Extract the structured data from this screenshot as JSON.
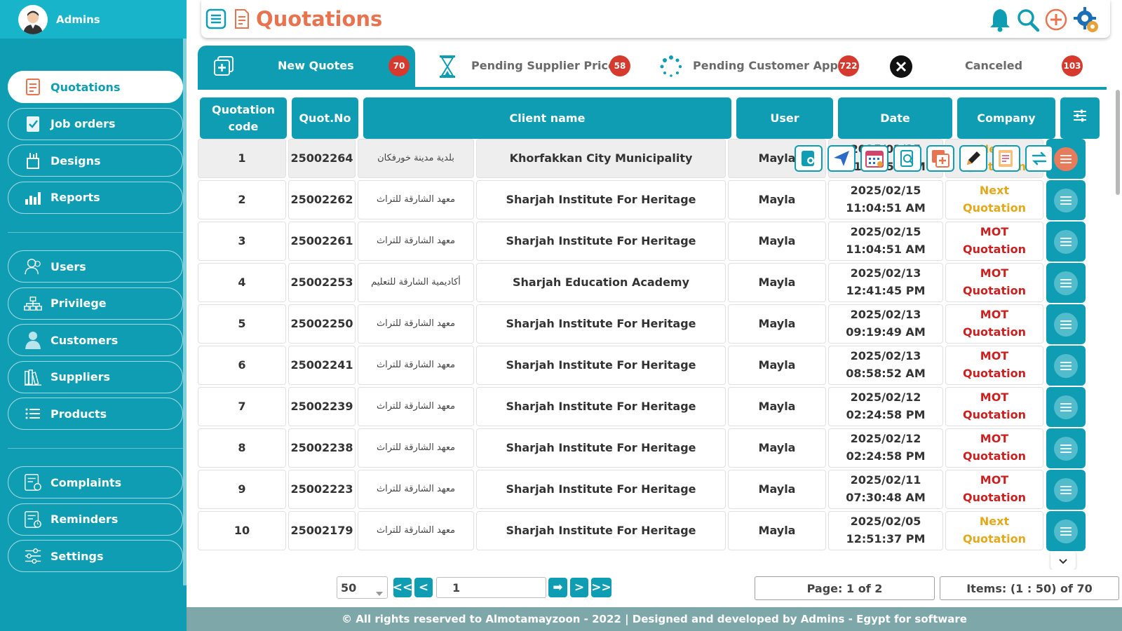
{
  "user": {
    "name": "Admins"
  },
  "nav": {
    "group1": [
      {
        "label": "Quotations",
        "icon": "quotation-icon",
        "active": true
      },
      {
        "label": "Job orders",
        "icon": "job-orders-icon"
      },
      {
        "label": "Designs",
        "icon": "designs-icon"
      },
      {
        "label": "Reports",
        "icon": "reports-icon"
      }
    ],
    "group2": [
      {
        "label": "Users",
        "icon": "users-icon"
      },
      {
        "label": "Privilege",
        "icon": "privilege-icon"
      },
      {
        "label": "Customers",
        "icon": "customers-icon"
      },
      {
        "label": "Suppliers",
        "icon": "suppliers-icon"
      },
      {
        "label": "Products",
        "icon": "products-icon"
      }
    ],
    "group3": [
      {
        "label": "Complaints",
        "icon": "complaints-icon"
      },
      {
        "label": "Reminders",
        "icon": "reminders-icon"
      },
      {
        "label": "Settings",
        "icon": "settings-icon"
      }
    ]
  },
  "header": {
    "title": "Quotations",
    "icons": [
      "bell-icon",
      "search-icon",
      "add-icon",
      "gear-icon"
    ]
  },
  "tabs": [
    {
      "label": "New Quotes",
      "count": "70",
      "icon": "add-box-icon",
      "active": true
    },
    {
      "label": "Pending Supplier Price",
      "count": "58",
      "icon": "hourglass-icon"
    },
    {
      "label": "Pending Customer Approval",
      "count": "722",
      "icon": "loading-dots-icon"
    },
    {
      "label": "Canceled",
      "count": "103",
      "icon": "cancel-icon"
    }
  ],
  "table": {
    "headers": [
      "Quotation code",
      "Quot.No",
      "Client name",
      "User",
      "Date",
      "Company"
    ],
    "rows": [
      {
        "code": "1",
        "quot_no": "25002264",
        "client_ar": "بلدية مدينة خورفكان",
        "client_en": "Khorfakkan City Municipality",
        "user": "Mayla",
        "date": "2025/02/15",
        "time": "11:04:51 AM",
        "company": "Next Quotation",
        "company_line1": "Next",
        "company_line2": "Quotation",
        "company_type": "next"
      },
      {
        "code": "2",
        "quot_no": "25002262",
        "client_ar": "معهد الشارقة للتراث",
        "client_en": "Sharjah Institute For Heritage",
        "user": "Mayla",
        "date": "2025/02/15",
        "time": "11:04:51 AM",
        "company_line1": "Next",
        "company_line2": "Quotation",
        "company_type": "next"
      },
      {
        "code": "3",
        "quot_no": "25002261",
        "client_ar": "معهد الشارقة للتراث",
        "client_en": "Sharjah Institute For Heritage",
        "user": "Mayla",
        "date": "2025/02/15",
        "time": "11:04:51 AM",
        "company_line1": "MOT",
        "company_line2": "Quotation",
        "company_type": "mot"
      },
      {
        "code": "4",
        "quot_no": "25002253",
        "client_ar": "أكاديمية الشارقة للتعليم",
        "client_en": "Sharjah Education Academy",
        "user": "Mayla",
        "date": "2025/02/13",
        "time": "12:41:45 PM",
        "company_line1": "MOT",
        "company_line2": "Quotation",
        "company_type": "mot"
      },
      {
        "code": "5",
        "quot_no": "25002250",
        "client_ar": "معهد الشارقة للتراث",
        "client_en": "Sharjah Institute For Heritage",
        "user": "Mayla",
        "date": "2025/02/13",
        "time": "09:19:49 AM",
        "company_line1": "MOT",
        "company_line2": "Quotation",
        "company_type": "mot"
      },
      {
        "code": "6",
        "quot_no": "25002241",
        "client_ar": "معهد الشارقة للتراث",
        "client_en": "Sharjah Institute For Heritage",
        "user": "Mayla",
        "date": "2025/02/13",
        "time": "08:58:52 AM",
        "company_line1": "MOT",
        "company_line2": "Quotation",
        "company_type": "mot"
      },
      {
        "code": "7",
        "quot_no": "25002239",
        "client_ar": "معهد الشارقة للتراث",
        "client_en": "Sharjah Institute For Heritage",
        "user": "Mayla",
        "date": "2025/02/12",
        "time": "02:24:58 PM",
        "company_line1": "MOT",
        "company_line2": "Quotation",
        "company_type": "mot"
      },
      {
        "code": "8",
        "quot_no": "25002238",
        "client_ar": "معهد الشارقة للتراث",
        "client_en": "Sharjah Institute For Heritage",
        "user": "Mayla",
        "date": "2025/02/12",
        "time": "02:24:58 PM",
        "company_line1": "MOT",
        "company_line2": "Quotation",
        "company_type": "mot"
      },
      {
        "code": "9",
        "quot_no": "25002223",
        "client_ar": "معهد الشارقة للتراث",
        "client_en": "Sharjah Institute For Heritage",
        "user": "Mayla",
        "date": "2025/02/11",
        "time": "07:30:48 AM",
        "company_line1": "MOT",
        "company_line2": "Quotation",
        "company_type": "mot"
      },
      {
        "code": "10",
        "quot_no": "25002179",
        "client_ar": "معهد الشارقة للتراث",
        "client_en": "Sharjah Institute For Heritage",
        "user": "Mayla",
        "date": "2025/02/05",
        "time": "12:51:37 PM",
        "company_line1": "Next",
        "company_line2": "Quotation",
        "company_type": "next"
      }
    ],
    "row_actions": [
      "view-icon",
      "send-icon",
      "calendar-icon",
      "preview-icon",
      "duplicate-icon",
      "edit-icon",
      "report-icon",
      "transfer-icon"
    ]
  },
  "pager": {
    "page_size": "50",
    "first": "<<",
    "prev": "<",
    "page_value": "1",
    "go": "➡",
    "next": ">",
    "last": ">>",
    "page_info": "Page: 1 of 2",
    "items_info": "Items: (1 : 50) of 70"
  },
  "footer": "© All rights reserved to Almotamayzoon - 2022 | Designed and developed by Admins - Egypt for software",
  "colors": {
    "primary": "#0e9db3",
    "accent": "#e8734f",
    "badge": "#d63a2f",
    "mot": "#cc1f1f",
    "next": "#e4a81b"
  }
}
